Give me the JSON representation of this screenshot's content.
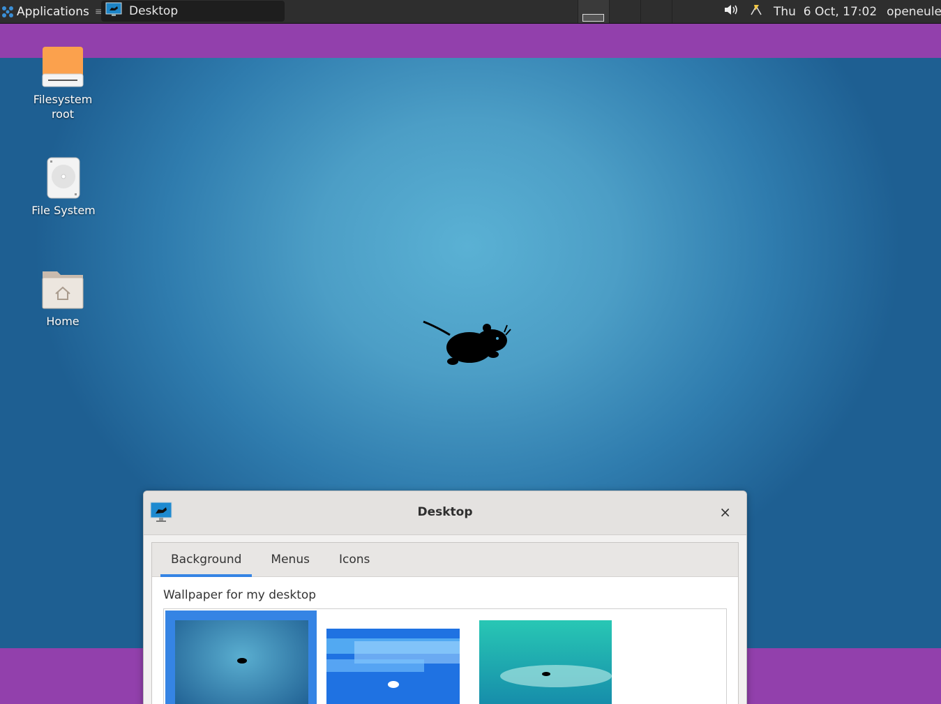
{
  "panel": {
    "applications_label": "Applications",
    "applications_separator": "≡",
    "task_label": "Desktop",
    "clock": "Thu  6 Oct, 17:02",
    "user": "openeuler"
  },
  "desktop_icons": [
    {
      "label": "Filesystem root",
      "icon": "drive-icon"
    },
    {
      "label": "File System",
      "icon": "harddisk-icon"
    },
    {
      "label": "Home",
      "icon": "home-folder-icon"
    }
  ],
  "dialog": {
    "title": "Desktop",
    "close_label": "×",
    "tabs": [
      "Background",
      "Menus",
      "Icons"
    ],
    "active_tab": "Background",
    "section_label": "Wallpaper for my desktop",
    "wallpapers": [
      "xfce-blue",
      "xfce-stripes",
      "xfce-teal"
    ]
  },
  "colors": {
    "accent": "#3584e4",
    "panel": "#2e2e2e",
    "stripe": "#9240ac"
  }
}
